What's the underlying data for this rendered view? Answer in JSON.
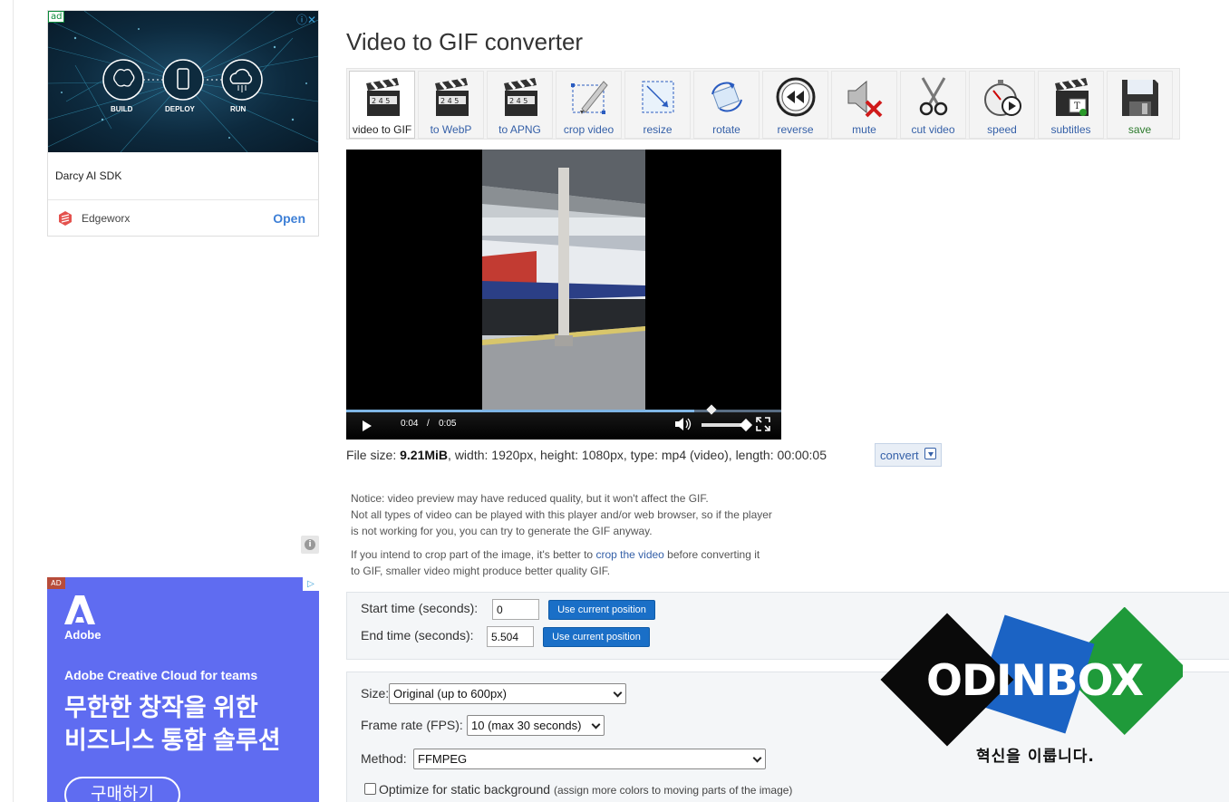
{
  "page": {
    "title": "Video to GIF converter"
  },
  "ads": {
    "top": {
      "badge": "ad",
      "labels": [
        "BUILD",
        "DEPLOY",
        "RUN"
      ],
      "title": "Darcy AI SDK",
      "brand": "Edgeworx",
      "cta": "Open"
    },
    "bottom": {
      "logo_text": "Adobe",
      "subtitle": "Adobe Creative Cloud for teams",
      "headline_1": "무한한 창작을 위한",
      "headline_2": "비즈니스 통합 솔루션",
      "cta": "구매하기"
    }
  },
  "toolbar": [
    {
      "label": "video to GIF",
      "icon": "clapperboard-icon",
      "active": true
    },
    {
      "label": "to WebP",
      "icon": "clapperboard-icon"
    },
    {
      "label": "to APNG",
      "icon": "clapperboard-icon"
    },
    {
      "label": "crop video",
      "icon": "crop-icon"
    },
    {
      "label": "resize",
      "icon": "resize-icon"
    },
    {
      "label": "rotate",
      "icon": "rotate-icon"
    },
    {
      "label": "reverse",
      "icon": "rewind-icon"
    },
    {
      "label": "mute",
      "icon": "mute-icon"
    },
    {
      "label": "cut video",
      "icon": "scissors-icon"
    },
    {
      "label": "speed",
      "icon": "stopwatch-icon"
    },
    {
      "label": "subtitles",
      "icon": "subtitles-icon"
    },
    {
      "label": "save",
      "icon": "floppy-disk-icon"
    }
  ],
  "player": {
    "current_time": "0:04",
    "separator": "/",
    "duration": "0:05",
    "progress_fraction": 0.8,
    "volume_fraction": 0.9
  },
  "file_info": {
    "prefix": "File size: ",
    "size": "9.21MiB",
    "details": ", width: 1920px, height: 1080px, type: mp4 (video), length: 00:00:05",
    "convert_label": "convert"
  },
  "notice": {
    "line1": "Notice: video preview may have reduced quality, but it won't affect the GIF.",
    "line2": "Not all types of video can be played with this player and/or web browser, so if the player",
    "line3": "is not working for you, you can try to generate the GIF anyway.",
    "line4_pre": "If you intend to crop part of the image, it's better to ",
    "line4_link": "crop the video",
    "line4_post": " before converting it",
    "line5": "to GIF, smaller video might produce better quality GIF."
  },
  "times": {
    "start_label": "Start time (seconds):",
    "start_value": "0",
    "end_label": "End time (seconds):",
    "end_value": "5.504",
    "use_current": "Use current position"
  },
  "options": {
    "size_label": "Size:",
    "size_value": "Original (up to 600px)",
    "fps_label": "Frame rate (FPS):",
    "fps_value": "10 (max 30 seconds)",
    "method_label": "Method:",
    "method_value": "FFMPEG",
    "optimize_label": "Optimize for static background",
    "optimize_note": "(assign more colors to moving parts of the image)",
    "optimize_checked": false
  },
  "watermark": {
    "name": "ODINBOX",
    "tagline": "혁신을 이룹니다."
  },
  "colors": {
    "link": "#3560a8",
    "button": "#1a6fc7",
    "adobe_bg": "#5f6cf1"
  }
}
